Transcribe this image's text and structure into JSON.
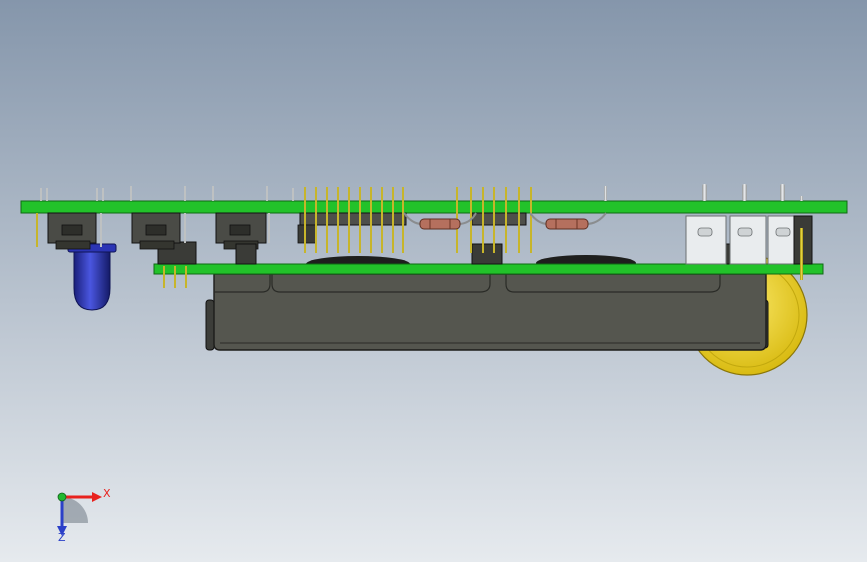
{
  "viewport": {
    "background_top": "#8596ab",
    "background_bottom": "#e6eaee"
  },
  "colors": {
    "pcb": "#22c22a",
    "pcb_edge": "#0f6a13",
    "housing": "#55564f",
    "housing_edge": "#1c1c1a",
    "pin_gold": "#d8c21a",
    "pin_silver": "#c8cbcd",
    "led_blue": "#2b34b4",
    "battery_yellow": "#efd632",
    "resistor": "#b5705e",
    "connector_white": "#e9ecee"
  },
  "icons": {
    "led": "blue-led-icon",
    "battery": "coin-cell-battery-icon",
    "resistor": "axial-resistor-icon",
    "triad": "coordinate-triad-icon"
  },
  "triad": {
    "x_label": "X",
    "z_label": "Z",
    "x_color": "#e8221e",
    "z_color": "#2b40c8",
    "y_color": "#22b830"
  }
}
